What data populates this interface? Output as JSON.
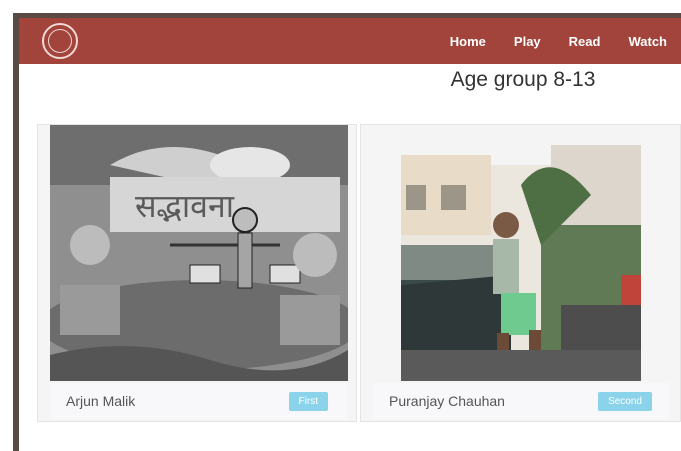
{
  "nav": {
    "items": [
      "Home",
      "Play",
      "Read",
      "Watch"
    ]
  },
  "page": {
    "title": "Age group 8-13"
  },
  "cards": [
    {
      "name": "Arjun Malik",
      "badge": "First",
      "image": "pencil-drawing"
    },
    {
      "name": "Puranjay Chauhan",
      "badge": "Second",
      "image": "boy-on-balcony-photo"
    }
  ],
  "colors": {
    "navbar": "#a2443b",
    "badge": "#8ad3ea",
    "frame": "#5a4a44"
  }
}
